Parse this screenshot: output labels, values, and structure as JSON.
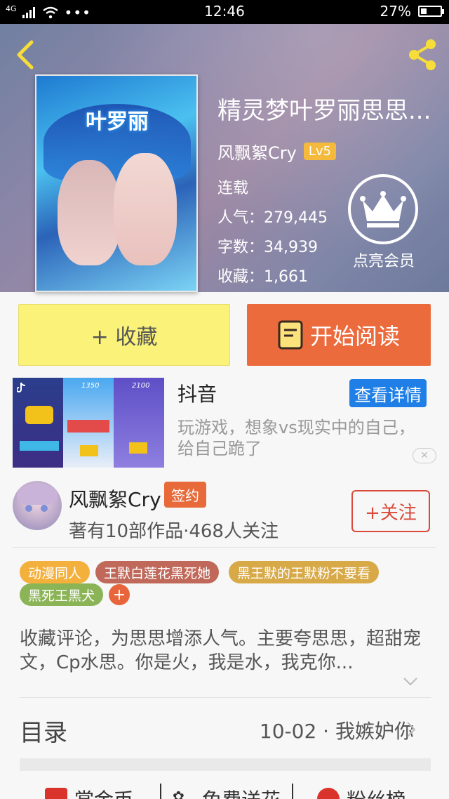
{
  "status_bar": {
    "network": "4G",
    "time": "12:46",
    "battery": "27%"
  },
  "book": {
    "title": "精灵梦叶罗丽思思...",
    "cover_text": "叶罗丽",
    "author": "风飘絮Cry",
    "level": "Lv5",
    "status": "连载",
    "popularity_label": "人气：",
    "popularity": "279,445",
    "words_label": "字数：",
    "words": "34,939",
    "favorites_label": "收藏：",
    "favorites": "1,661"
  },
  "vip": {
    "label": "点亮会员"
  },
  "actions": {
    "collect_label": "+ 收藏",
    "read_label": "开始阅读"
  },
  "ad": {
    "title": "抖音",
    "detail_label": "查看详情",
    "description": "玩游戏，想象vs现实中的自己，给自己跪了",
    "thumb_numbers": [
      "1350",
      "2100"
    ]
  },
  "author_block": {
    "name": "风飘絮Cry",
    "badge": "签约",
    "meta": "著有10部作品·468人关注",
    "follow_label": "+关注"
  },
  "tags": [
    {
      "label": "动漫同人",
      "color": "#f4b03c"
    },
    {
      "label": "王默白莲花黑死她",
      "color": "#c0695a"
    },
    {
      "label": "黑王默的王默粉不要看",
      "color": "#d8a947"
    },
    {
      "label": "黑死王黑犬",
      "color": "#8bb457"
    }
  ],
  "tag_add": "+",
  "description": "收藏评论，为思思增添人气。主要夸思思，超甜宠文，Cp水思。你是火，我是水，我克你...",
  "toc": {
    "label": "目录",
    "latest": "10-02 · 我嫉妒你"
  },
  "bottom_bar": [
    {
      "label": "赏金币"
    },
    {
      "label": "免费送花"
    },
    {
      "label": "粉丝榜"
    }
  ],
  "colors": {
    "accent": "#ec6b3d",
    "collect": "#fbf27a",
    "follow": "#d94a3a",
    "ad_button": "#1f7fe6"
  }
}
